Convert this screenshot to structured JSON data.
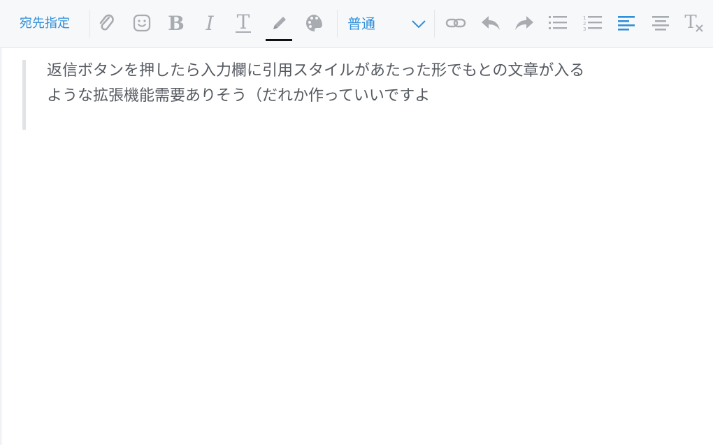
{
  "toolbar": {
    "recipient_label": "宛先指定",
    "font_size_value": "普通",
    "icons": {
      "attach": "paperclip-icon",
      "emoji": "smiley-icon",
      "bold": "bold-icon",
      "italic": "italic-icon",
      "underline": "underline-icon",
      "highlight": "pencil-icon",
      "color": "palette-icon",
      "font_size_dropdown": "chevron-down-icon",
      "link": "link-icon",
      "undo": "reply-arrow-icon",
      "redo": "forward-arrow-icon",
      "bullet_list": "bullet-list-icon",
      "numbered_list": "numbered-list-icon",
      "align_left": "align-left-icon",
      "align_center": "align-center-icon",
      "clear_format": "clear-format-icon"
    },
    "colors": {
      "accent": "#2f8fd8",
      "icon_gray": "#a8acb1",
      "active": "#2f8fd8"
    }
  },
  "content": {
    "quote_lines": [
      "返信ボタンを押したら入力欄に引用スタイルがあたった形でもとの文章が入る",
      "ような拡張機能需要ありそう（だれか作っていいですよ"
    ]
  }
}
